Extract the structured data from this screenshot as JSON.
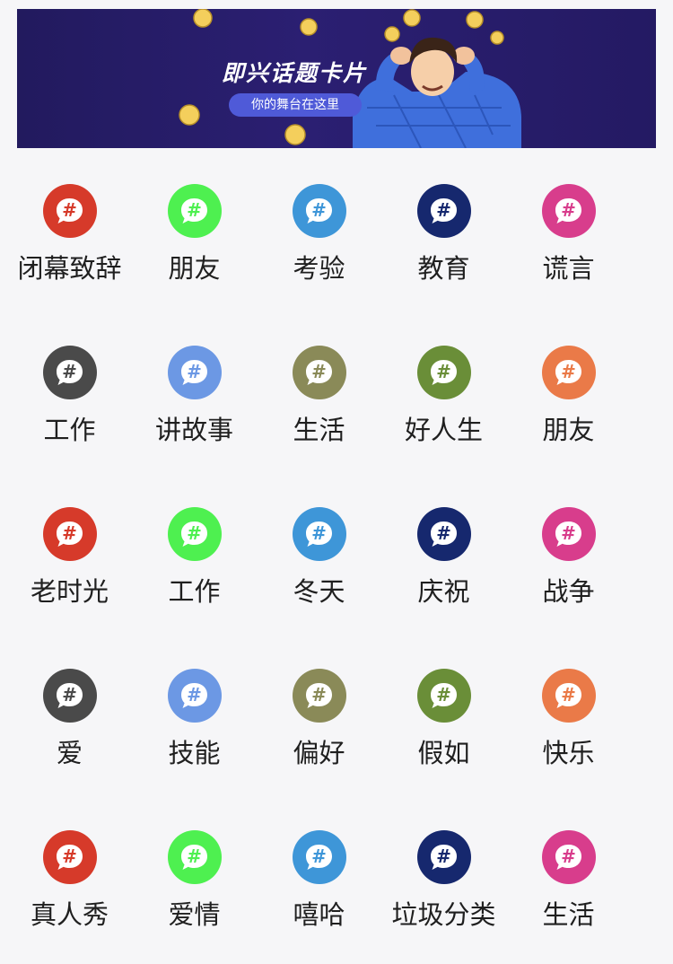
{
  "banner": {
    "title": "即兴话题卡片",
    "subtitle": "你的舞台在这里"
  },
  "icon_glyph": "#",
  "topics": [
    {
      "label": "闭幕致辞",
      "color": "#d63a2a"
    },
    {
      "label": "朋友",
      "color": "#4ef050"
    },
    {
      "label": "考验",
      "color": "#3e96d8"
    },
    {
      "label": "教育",
      "color": "#16286e"
    },
    {
      "label": "谎言",
      "color": "#d83d8c"
    },
    {
      "label": "工作",
      "color": "#4a4a4a"
    },
    {
      "label": "讲故事",
      "color": "#6c98e4"
    },
    {
      "label": "生活",
      "color": "#8a8a58"
    },
    {
      "label": "好人生",
      "color": "#6a8e38"
    },
    {
      "label": "朋友",
      "color": "#ea7a48"
    },
    {
      "label": "老时光",
      "color": "#d63a2a"
    },
    {
      "label": "工作",
      "color": "#4ef050"
    },
    {
      "label": "冬天",
      "color": "#3e96d8"
    },
    {
      "label": "庆祝",
      "color": "#16286e"
    },
    {
      "label": "战争",
      "color": "#d83d8c"
    },
    {
      "label": "爱",
      "color": "#4a4a4a"
    },
    {
      "label": "技能",
      "color": "#6c98e4"
    },
    {
      "label": "偏好",
      "color": "#8a8a58"
    },
    {
      "label": "假如",
      "color": "#6a8e38"
    },
    {
      "label": "快乐",
      "color": "#ea7a48"
    },
    {
      "label": "真人秀",
      "color": "#d63a2a"
    },
    {
      "label": "爱情",
      "color": "#4ef050"
    },
    {
      "label": "嘻哈",
      "color": "#3e96d8"
    },
    {
      "label": "垃圾分类",
      "color": "#16286e"
    },
    {
      "label": "生活",
      "color": "#d83d8c"
    }
  ]
}
